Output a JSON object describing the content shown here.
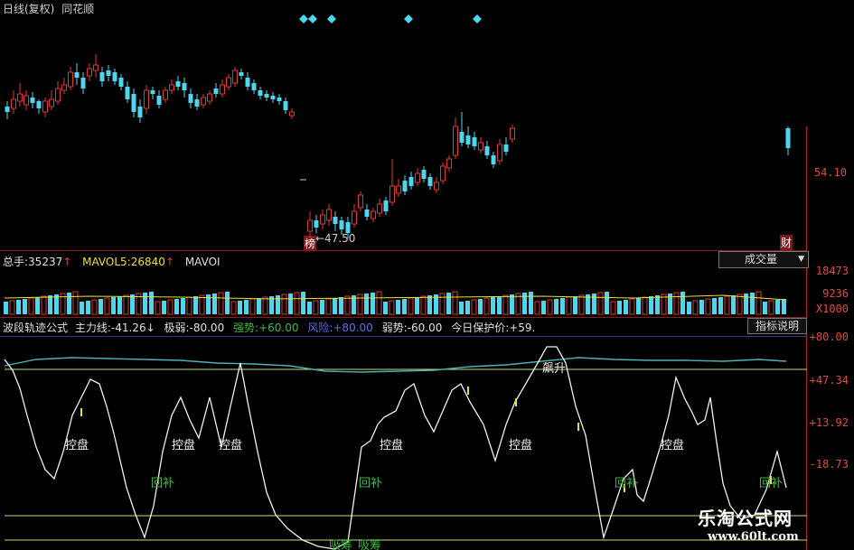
{
  "header": {
    "title": "日线(复权)",
    "source": "同花顺"
  },
  "price_panel": {
    "price_ticks": [
      "54.10"
    ],
    "low_label": "←47.50",
    "low_tag": "榜",
    "right_tag": "财"
  },
  "volume_panel": {
    "total_label": "总手:",
    "total_value": "35237",
    "mavol5_label": "MAVOL5:",
    "mavol5_value": "26840",
    "mavol_trunc": "MAVOI",
    "volume_dropdown": "成交量",
    "ticks": [
      "18473",
      "9236",
      "X1000"
    ]
  },
  "indicator_panel": {
    "name": "波段轨迹公式",
    "main_line_label": "主力线:",
    "main_line_value": "-41.26",
    "weak_extreme_label": "极弱:",
    "weak_extreme_value": "-80.00",
    "strong_label": "强势:",
    "strong_value": "+60.00",
    "risk_label": "风险:",
    "risk_value": "+80.00",
    "weak_label": "弱势:",
    "weak_value": "-60.00",
    "protect_label": "今日保护价:",
    "protect_value": "+59.",
    "help_button": "指标说明",
    "ticks": [
      "+80.00",
      "+47.34",
      "+13.92",
      "-18.73"
    ],
    "annotations": [
      "控盘",
      "控盘",
      "控盘",
      "控盘",
      "控盘",
      "控盘",
      "回补",
      "回补",
      "回补",
      "回补",
      "飙升",
      "吸筹",
      "吸筹"
    ]
  },
  "watermark": {
    "name": "乐淘公式网",
    "url": "www.60lt.com"
  },
  "colors": {
    "up": "#e03a2f",
    "down": "#4fd6ef",
    "axis": "#b8231c",
    "white_line": "#f0f0f0",
    "cyan_line": "#4fb0b0",
    "strong_green": "#3dbb3d",
    "risk_blue": "#5b6ff0",
    "yellow": "#e8e23a"
  }
}
